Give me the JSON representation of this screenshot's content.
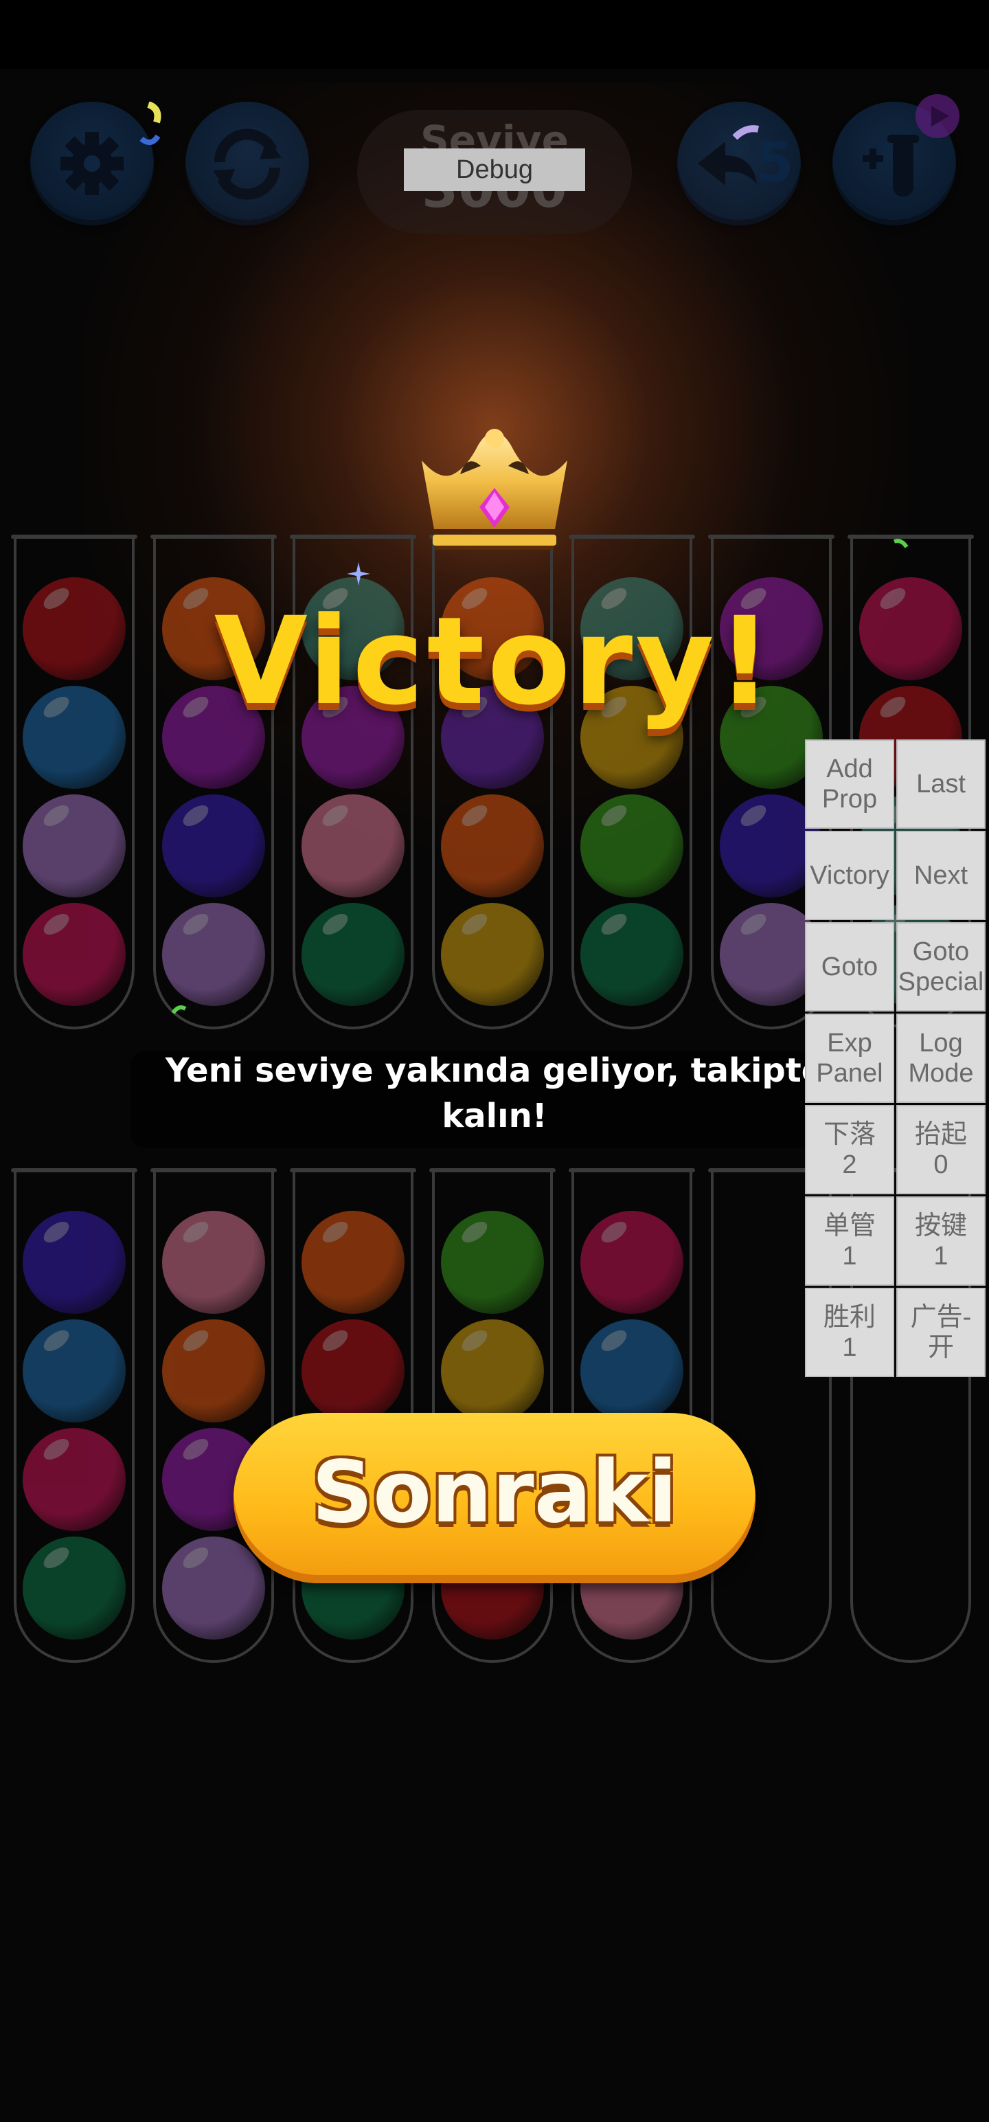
{
  "header": {
    "level_label": "Seviye",
    "level_number": "3000",
    "debug_label": "Debug",
    "undo_count": "5"
  },
  "victory": {
    "title": "Victory!",
    "subtitle": "Yeni seviye yakında geliyor, takipte kalın!",
    "next_label": "Sonraki"
  },
  "debug_panel": {
    "buttons": [
      "Add\nProp",
      "Last",
      "Victory",
      "Next",
      "Goto",
      "Goto\nSpecial",
      "Exp\nPanel",
      "Log\nMode",
      "下落\n2",
      "抬起\n0",
      "单管\n1",
      "按键\n1",
      "胜利\n1",
      "广告-开"
    ]
  },
  "tubes": {
    "top_row": [
      [
        "red",
        "blue",
        "lavender",
        "crimson"
      ],
      [
        "orange",
        "purple",
        "indigo",
        "lavender"
      ],
      [
        "teal",
        "purple",
        "pink",
        "darkgreen"
      ],
      [
        "orange",
        "violet",
        "orange",
        "yellow"
      ],
      [
        "teal",
        "yellow",
        "green",
        "darkgreen"
      ],
      [
        "purple",
        "green",
        "indigo",
        "lavender"
      ],
      [
        "crimson",
        "red",
        "teal",
        "teal"
      ]
    ],
    "bottom_row": [
      [
        "indigo",
        "blue",
        "crimson",
        "darkgreen"
      ],
      [
        "pink",
        "orange",
        "purple",
        "lavender"
      ],
      [
        "orange",
        "red",
        "red",
        "darkgreen"
      ],
      [
        "green",
        "yellow",
        "yellow",
        "red"
      ],
      [
        "crimson",
        "blue",
        "pink",
        "pink"
      ],
      [],
      []
    ]
  },
  "colors": {
    "red": "#b8141c",
    "blue": "#1f6fb0",
    "lavender": "#a676c8",
    "crimson": "#d0155a",
    "orange": "#e85a12",
    "purple": "#9b1fb0",
    "indigo": "#3b1fb8",
    "teal": "#3a8a7a",
    "pink": "#e27a9a",
    "darkgreen": "#0e7a4a",
    "violet": "#6a2ab8",
    "yellow": "#d9a80e",
    "green": "#3aa01e",
    "accent_gold": "#ffd21a",
    "button_blue": "#143a68"
  },
  "icons": [
    "gear-icon",
    "restart-icon",
    "undo-icon",
    "add-tube-icon",
    "play-badge-icon",
    "crown-icon"
  ]
}
